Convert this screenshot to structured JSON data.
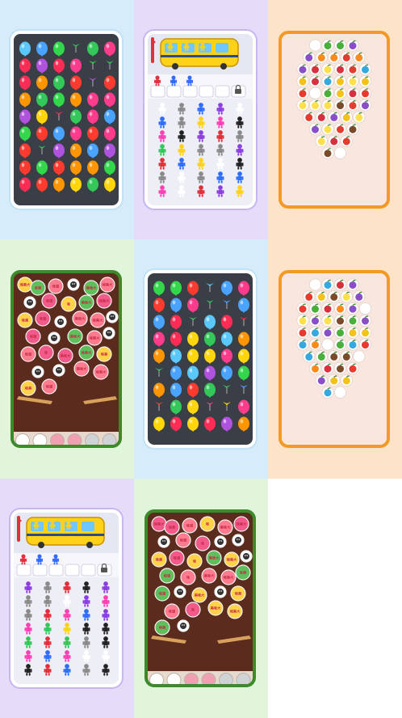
{
  "grid": {
    "cells": [
      {
        "kind": "balloon",
        "bg": "#d6ecfb"
      },
      {
        "kind": "bus",
        "bg": "#e4dcf8"
      },
      {
        "kind": "fruit",
        "bg": "#fde3c7"
      },
      {
        "kind": "coin",
        "bg": "#e0f5da"
      },
      {
        "kind": "balloon",
        "bg": "#d6ecfb"
      },
      {
        "kind": "fruit",
        "bg": "#fde3c7"
      },
      {
        "kind": "bus",
        "bg": "#e4dcf8"
      },
      {
        "kind": "coin",
        "bg": "#e0f5da"
      }
    ]
  },
  "coin_labels": [
    "味美大",
    "味美",
    "味道",
    "味",
    "美味大"
  ],
  "icons": [
    "padlock-icon",
    "smiley-icon",
    "heart-icon",
    "mask-icon"
  ]
}
